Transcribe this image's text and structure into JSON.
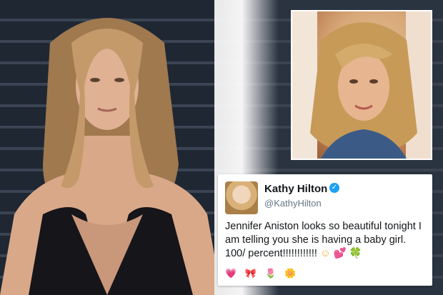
{
  "tweet": {
    "name": "Kathy Hilton",
    "handle": "@KathyHilton",
    "verified_icon": "verified-check-icon",
    "text": "Jennifer Aniston looks so beautiful tonight I am telling you she is having a baby girl.  100/ percent!!!!!!!!!!!!",
    "emoji_inline": "☺ 💕",
    "emoji_clover": "🍀",
    "emoji_row": "💗 🎀 🌷 🌼"
  },
  "colors": {
    "verified": "#1da1f2",
    "text": "#14171a",
    "handle": "#657786"
  }
}
